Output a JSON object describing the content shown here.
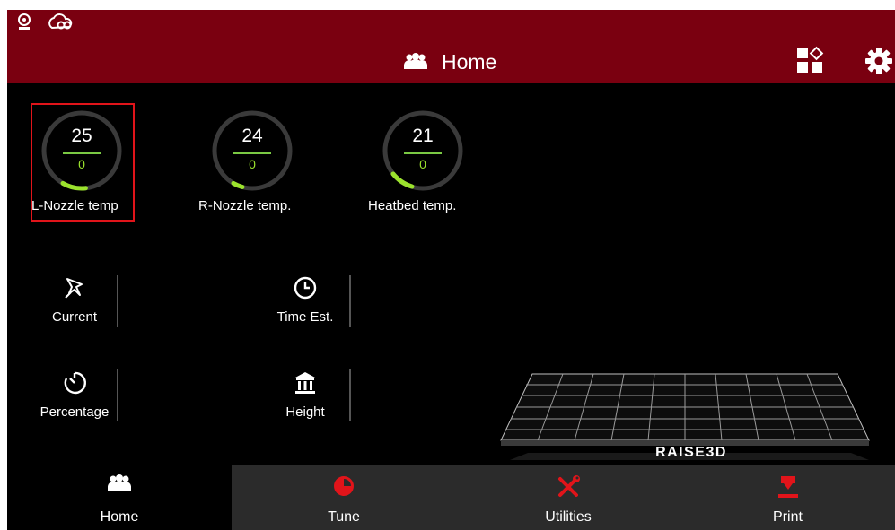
{
  "header": {
    "title": "Home",
    "title_icon": "users-icon",
    "status_icons": [
      "webcam-icon",
      "cloud-link-icon"
    ],
    "buttons": [
      "apps-grid-icon",
      "gear-icon"
    ],
    "background": "#7a0010"
  },
  "temperatures": [
    {
      "label": "L-Nozzle temp",
      "current": "25",
      "target": "0",
      "selected": true
    },
    {
      "label": "R-Nozzle temp.",
      "current": "24",
      "target": "0",
      "selected": false
    },
    {
      "label": "Heatbed temp.",
      "current": "21",
      "target": "0",
      "selected": false
    }
  ],
  "stats": {
    "current": {
      "label": "Current",
      "icon": "pin-icon"
    },
    "time_est": {
      "label": "Time Est.",
      "icon": "clock-icon"
    },
    "percentage": {
      "label": "Percentage",
      "icon": "timer-icon"
    },
    "height": {
      "label": "Height",
      "icon": "pillars-icon"
    }
  },
  "brand": {
    "logo_text": "RAISE3D"
  },
  "nav": [
    {
      "label": "Home",
      "icon": "users-icon",
      "active": true
    },
    {
      "label": "Tune",
      "icon": "pie-icon",
      "active": false
    },
    {
      "label": "Utilities",
      "icon": "tools-icon",
      "active": false
    },
    {
      "label": "Print",
      "icon": "print-nozzle-icon",
      "active": false
    }
  ],
  "colors": {
    "accent": "#e1141a",
    "gauge_arc": "#9be22d",
    "header": "#7a0010",
    "nav_bg": "#2b2b2b"
  }
}
